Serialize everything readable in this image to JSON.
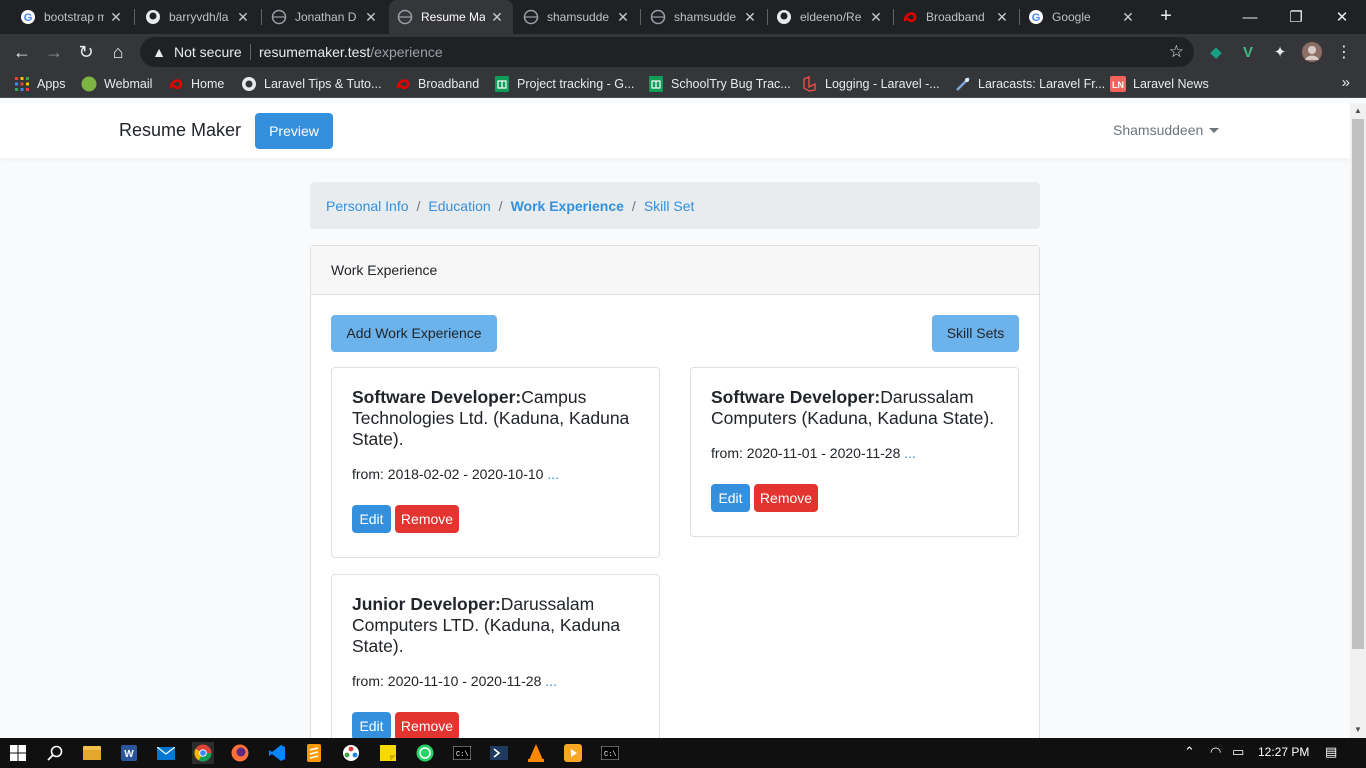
{
  "browser": {
    "tabs": [
      {
        "title": "bootstrap m",
        "icon": "google-icon",
        "active": false
      },
      {
        "title": "barryvdh/la",
        "icon": "github-icon",
        "active": false
      },
      {
        "title": "Jonathan D",
        "icon": "globe-icon",
        "active": false
      },
      {
        "title": "Resume Ma",
        "icon": "globe-icon",
        "active": true
      },
      {
        "title": "shamsudde",
        "icon": "globe-icon",
        "active": false
      },
      {
        "title": "shamsudde",
        "icon": "globe-icon",
        "active": false
      },
      {
        "title": "eldeeno/Re",
        "icon": "github-icon",
        "active": false
      },
      {
        "title": "Broadband",
        "icon": "airtel-icon",
        "active": false
      },
      {
        "title": "Google",
        "icon": "google-icon",
        "active": false
      }
    ],
    "not_secure": "Not secure",
    "url_host": "resumemaker.test",
    "url_path": "/experience",
    "bookmarks": [
      {
        "label": "Apps",
        "icon": "apps-grid-icon"
      },
      {
        "label": "Webmail",
        "icon": "webmail-icon"
      },
      {
        "label": "Home",
        "icon": "airtel-icon"
      },
      {
        "label": "Laravel Tips & Tuto...",
        "icon": "globe-icon"
      },
      {
        "label": "Broadband",
        "icon": "airtel-icon"
      },
      {
        "label": "Project tracking - G...",
        "icon": "sheets-icon"
      },
      {
        "label": "SchoolTry Bug Trac...",
        "icon": "sheets-icon"
      },
      {
        "label": "Logging - Laravel -...",
        "icon": "laravel-icon"
      },
      {
        "label": "Laracasts: Laravel Fr...",
        "icon": "laracasts-icon"
      },
      {
        "label": "Laravel News",
        "icon": "laravel-news-icon"
      }
    ]
  },
  "app": {
    "brand": "Resume Maker",
    "preview_label": "Preview",
    "user_name": "Shamsuddeen"
  },
  "breadcrumb": [
    {
      "label": "Personal Info",
      "active": false
    },
    {
      "label": "Education",
      "active": false
    },
    {
      "label": "Work Experience",
      "active": true
    },
    {
      "label": "Skill Set",
      "active": false
    }
  ],
  "card": {
    "header": "Work Experience",
    "add_label": "Add Work Experience",
    "skills_label": "Skill Sets"
  },
  "experiences": [
    {
      "role": "Software Developer:",
      "company": "Campus Technologies Ltd. (Kaduna, Kaduna State).",
      "dates": "from: 2018-02-02 - 2020-10-10",
      "more": "...",
      "edit": "Edit",
      "remove": "Remove"
    },
    {
      "role": "Software Developer:",
      "company": "Darussalam Computers (Kaduna, Kaduna State).",
      "dates": "from: 2020-11-01 - 2020-11-28",
      "more": "...",
      "edit": "Edit",
      "remove": "Remove"
    },
    {
      "role": "Junior Developer:",
      "company": "Darussalam Computers LTD. (Kaduna, Kaduna State).",
      "dates": "from: 2020-11-10 - 2020-11-28",
      "more": "...",
      "edit": "Edit",
      "remove": "Remove"
    }
  ],
  "taskbar": {
    "clock": "12:27 PM"
  },
  "colors": {
    "primary": "#3490dc",
    "info": "#6cb2eb",
    "danger": "#e3342f",
    "breadcrumb_bg": "#e9ecef"
  }
}
